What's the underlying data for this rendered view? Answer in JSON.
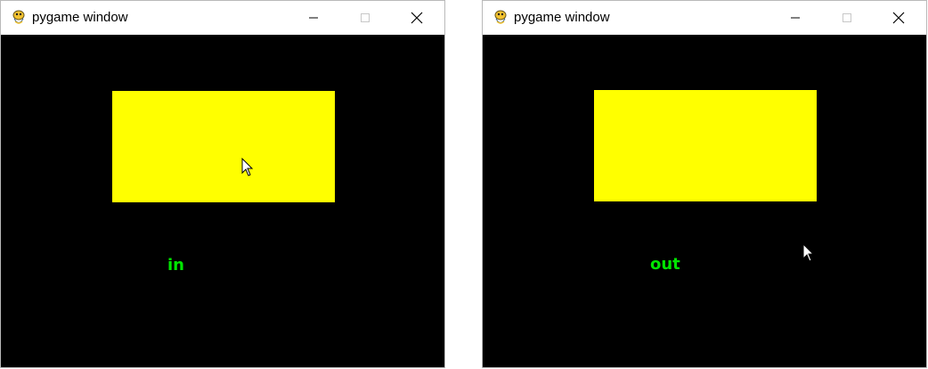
{
  "colors": {
    "rect": "#ffff00",
    "text": "#00e600",
    "background": "#000000"
  },
  "windows": [
    {
      "title": "pygame window",
      "status_text": "in",
      "controls": {
        "minimize": "minimize-icon",
        "maximize": "maximize-icon",
        "close": "close-icon"
      }
    },
    {
      "title": "pygame window",
      "status_text": "out",
      "controls": {
        "minimize": "minimize-icon",
        "maximize": "maximize-icon",
        "close": "close-icon"
      }
    }
  ]
}
